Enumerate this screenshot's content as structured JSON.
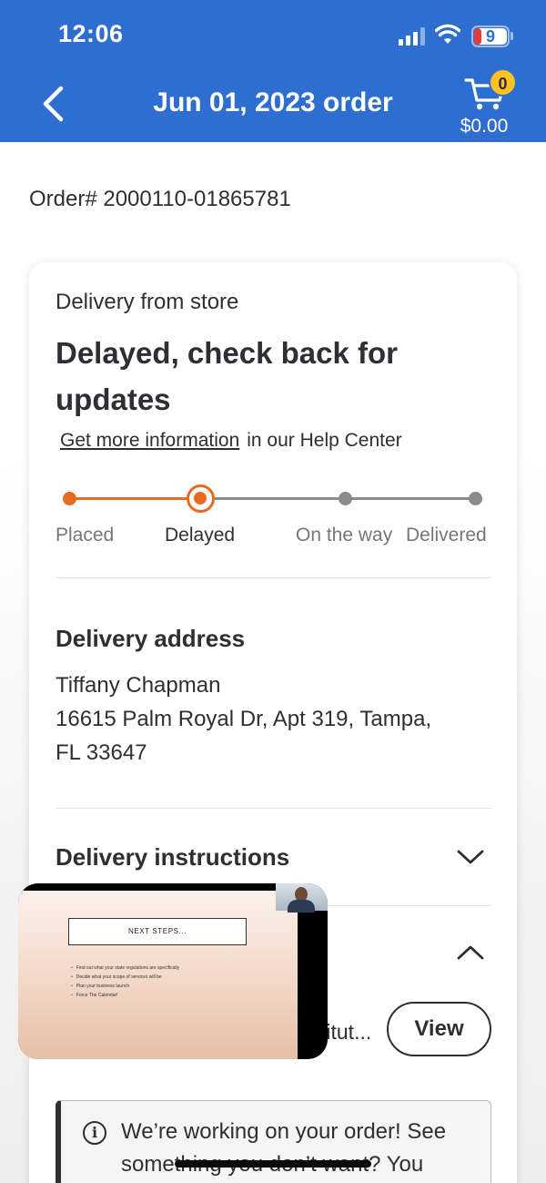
{
  "status_bar": {
    "time": "12:06",
    "battery_level": "9",
    "battery_color": "#e33b3b"
  },
  "header": {
    "title": "Jun 01, 2023 order",
    "back_icon": "chevron-left-icon",
    "cart_icon": "cart-icon",
    "cart_count": "0",
    "cart_total": "$0.00",
    "background_color": "#2f6ed1",
    "badge_color": "#ffc220"
  },
  "order": {
    "number_label": "Order# 2000110-01865781"
  },
  "status_card": {
    "delivery_type": "Delivery from store",
    "headline": "Delayed, check back for updates",
    "help_link": "Get more information",
    "help_suffix": "in our Help Center",
    "progress": {
      "steps": [
        "Placed",
        "Delayed",
        "On the way",
        "Delivered"
      ],
      "current_step_index": 1,
      "active_color": "#e86a1f",
      "inactive_color": "#8a8b8f"
    }
  },
  "delivery_address": {
    "heading": "Delivery address",
    "name": "Tiffany Chapman",
    "line1": "16615 Palm Royal Dr, Apt 319, Tampa,",
    "line2": "FL 33647"
  },
  "delivery_instructions": {
    "heading": "Delivery instructions",
    "chevron_icon": "chevron-down-icon"
  },
  "collapsed_section": {
    "chevron_icon": "chevron-up-icon",
    "partial_text": "titut...",
    "view_button": "View"
  },
  "info_banner": {
    "icon": "info-icon",
    "text": "We’re working on your order! See something you don’t want? You"
  },
  "pip_video": {
    "slide_title": "NEXT STEPS...",
    "bullets": [
      "Find out what your state regulations are specifically",
      "Decide what your scope of services will be",
      "Plan your business launch",
      "Force The Calendar!"
    ]
  }
}
